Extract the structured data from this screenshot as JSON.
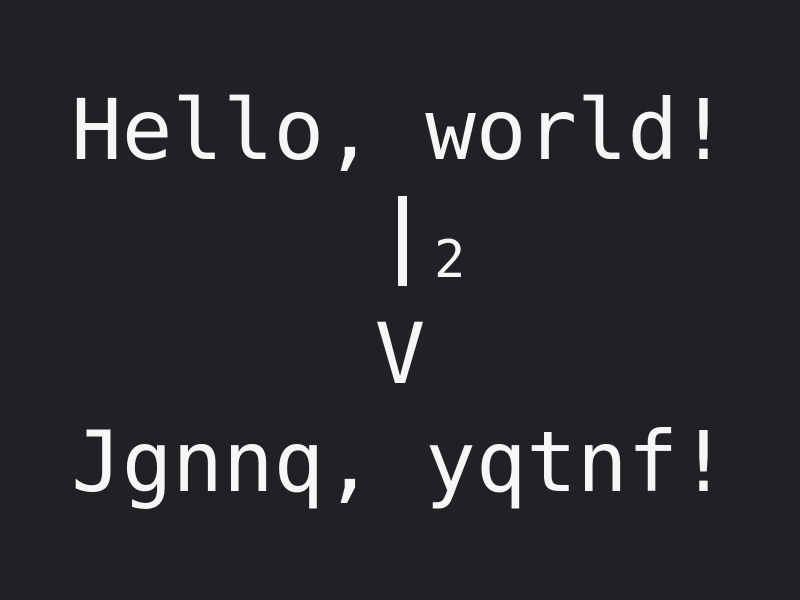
{
  "plaintext": "Hello, world!",
  "shift": "2",
  "arrow_head": "V",
  "ciphertext": "Jgnnq, yqtnf!",
  "colors": {
    "background": "#1f2124",
    "text": "#f5f6f6"
  }
}
